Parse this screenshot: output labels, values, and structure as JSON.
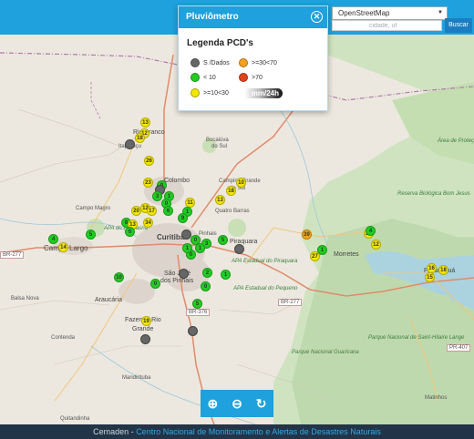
{
  "panel": {
    "title": "Pluviômetro",
    "close_icon": "close-icon",
    "legend_title": "Legenda PCD's",
    "legend": [
      {
        "label": "S /Dados",
        "color": "#666666"
      },
      {
        "label": ">=30<70",
        "color": "#f5a21e"
      },
      {
        "label": "< 10",
        "color": "#22cc22"
      },
      {
        "label": ">70",
        "color": "#e0441c"
      },
      {
        "label": ">=10<30",
        "color": "#f2e600"
      }
    ],
    "period_button": "mm/24h"
  },
  "layer_select": {
    "value": "OpenStreetMap"
  },
  "city_search": {
    "placeholder": "cidade, uf",
    "button": "Buscar"
  },
  "footer": {
    "prefix": "Cemaden - ",
    "link": "Centro Nacional de Monitoramento e Alertas de Desastres Naturais"
  },
  "zoom": {
    "zoom_in": "⊕",
    "zoom_out": "⊖",
    "refresh": "↻"
  },
  "labels": {
    "rio_branco": "Rio Branco",
    "itaperucu": "Itaperuçu",
    "bocaiuva": "Bocaiúva",
    "do_sul": "do Sul",
    "colombo": "Colombo",
    "campina": "Campina Grande",
    "do_sul2": "do Sul",
    "quatro_barras": "Quatro Barras",
    "campo_magro": "Campo Magro",
    "curitiba": "Curitiba",
    "pinhais": "Pinhais",
    "piraquara": "Piraquara",
    "campo_largo": "Campo Largo",
    "balsa_nova": "Balsa Nova",
    "araucaria": "Araucária",
    "sao_jose": "São José",
    "dos_pinhais": "dos Pinhais",
    "fazenda_rio": "Fazenda Rio",
    "grande": "Grande",
    "contenda": "Contenda",
    "mandirituba": "Mandirituba",
    "quitandinha": "Quitandinha",
    "morretes": "Morretes",
    "paranagua": "Paranaguá",
    "matinhos": "Matinhos",
    "br277": "BR-277",
    "br277b": "BR-277",
    "br376": "BR-376",
    "pr407": "PR-407",
    "apa_area": "Área de Proteção Ambiental de Guaraqueçaba",
    "reserva": "Reserva Biológica Bom Jesus",
    "parque_guaricana": "Parque Nacional Guaricana",
    "parque_saint": "Parque Nacional de Saint-Hilaire Lange",
    "apa_passauna": "APA do Passaúna",
    "apa_pirq": "APA Estadual do Piraquara",
    "apa_peq": "APA Estadual do Pequeno"
  },
  "markers": [
    {
      "v": "13",
      "c": "y"
    },
    {
      "v": "12",
      "c": "y"
    },
    {
      "v": "18",
      "c": "y"
    },
    {
      "v": "",
      "c": "k"
    },
    {
      "v": "26",
      "c": "y"
    },
    {
      "v": "23",
      "c": "y"
    },
    {
      "v": "0",
      "c": "g"
    },
    {
      "v": "",
      "c": "k"
    },
    {
      "v": "3",
      "c": "g"
    },
    {
      "v": "1",
      "c": "g"
    },
    {
      "v": "0",
      "c": "g"
    },
    {
      "v": "10",
      "c": "y"
    },
    {
      "v": "18",
      "c": "y"
    },
    {
      "v": "13",
      "c": "y"
    },
    {
      "v": "11",
      "c": "y"
    },
    {
      "v": "20",
      "c": "y"
    },
    {
      "v": "12",
      "c": "y"
    },
    {
      "v": "17",
      "c": "y"
    },
    {
      "v": "6",
      "c": "g"
    },
    {
      "v": "1",
      "c": "g"
    },
    {
      "v": "9",
      "c": "g"
    },
    {
      "v": "8",
      "c": "g"
    },
    {
      "v": "13",
      "c": "y"
    },
    {
      "v": "34",
      "c": "y"
    },
    {
      "v": "0",
      "c": "g"
    },
    {
      "v": "5",
      "c": "g"
    },
    {
      "v": "4",
      "c": "g"
    },
    {
      "v": "14",
      "c": "y"
    },
    {
      "v": "",
      "c": "k"
    },
    {
      "v": "5",
      "c": "g"
    },
    {
      "v": "",
      "c": "k"
    },
    {
      "v": "39",
      "c": "o"
    },
    {
      "v": "1",
      "c": "g"
    },
    {
      "v": "27",
      "c": "y"
    },
    {
      "v": "10",
      "c": "g"
    },
    {
      "v": "0",
      "c": "g"
    },
    {
      "v": "0",
      "c": "g"
    },
    {
      "v": "1",
      "c": "g"
    },
    {
      "v": "3",
      "c": "g"
    },
    {
      "v": "0",
      "c": "g"
    },
    {
      "v": "",
      "c": "k"
    },
    {
      "v": "1",
      "c": "g"
    },
    {
      "v": "5",
      "c": "g"
    },
    {
      "v": "19",
      "c": "y"
    },
    {
      "v": "",
      "c": "k"
    },
    {
      "v": "",
      "c": "k"
    },
    {
      "v": "12",
      "c": "y"
    },
    {
      "v": "25",
      "c": "y"
    },
    {
      "v": "15",
      "c": "y"
    },
    {
      "v": "16",
      "c": "y"
    },
    {
      "v": "18",
      "c": "y"
    },
    {
      "v": "4",
      "c": "g"
    },
    {
      "v": "2",
      "c": "g"
    },
    {
      "v": "0",
      "c": "g"
    },
    {
      "v": "1",
      "c": "g"
    }
  ]
}
